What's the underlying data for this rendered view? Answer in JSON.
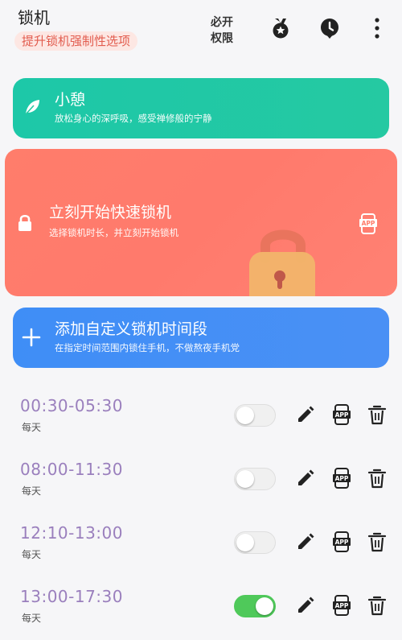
{
  "header": {
    "title": "锁机",
    "promo_badge": "提升锁机强制性选项",
    "permissions_line1": "必开",
    "permissions_line2": "权限",
    "icons": [
      "medal-icon",
      "clock-icon",
      "more-vertical-icon"
    ]
  },
  "cards": {
    "rest": {
      "title": "小憩",
      "subtitle": "放松身心的深呼吸，感受禅修般的宁静",
      "icon": "leaf-icon"
    },
    "quick_lock": {
      "title": "立刻开始快速锁机",
      "subtitle": "选择锁机时长，并立刻开始锁机",
      "icon": "lock-icon",
      "right_icon": "app-phone-icon"
    },
    "add_period": {
      "title": "添加自定义锁机时间段",
      "subtitle": "在指定时间范围内锁住手机，不做熬夜手机党",
      "icon": "plus-icon"
    }
  },
  "schedules": [
    {
      "time": "00:30-05:30",
      "repeat": "每天",
      "enabled": false
    },
    {
      "time": "08:00-11:30",
      "repeat": "每天",
      "enabled": false
    },
    {
      "time": "12:10-13:00",
      "repeat": "每天",
      "enabled": false
    },
    {
      "time": "13:00-17:30",
      "repeat": "每天",
      "enabled": true
    }
  ],
  "row_icons": [
    "edit-icon",
    "app-phone-icon",
    "trash-icon"
  ],
  "app_icon_text": "APP",
  "colors": {
    "rest_card": "#1dc8a8",
    "quick_card": "#ff7d6b",
    "add_card": "#3f8ef6",
    "time_text": "#9a7fbd",
    "switch_on": "#4fc95a",
    "promo_text": "#e25c4e"
  }
}
